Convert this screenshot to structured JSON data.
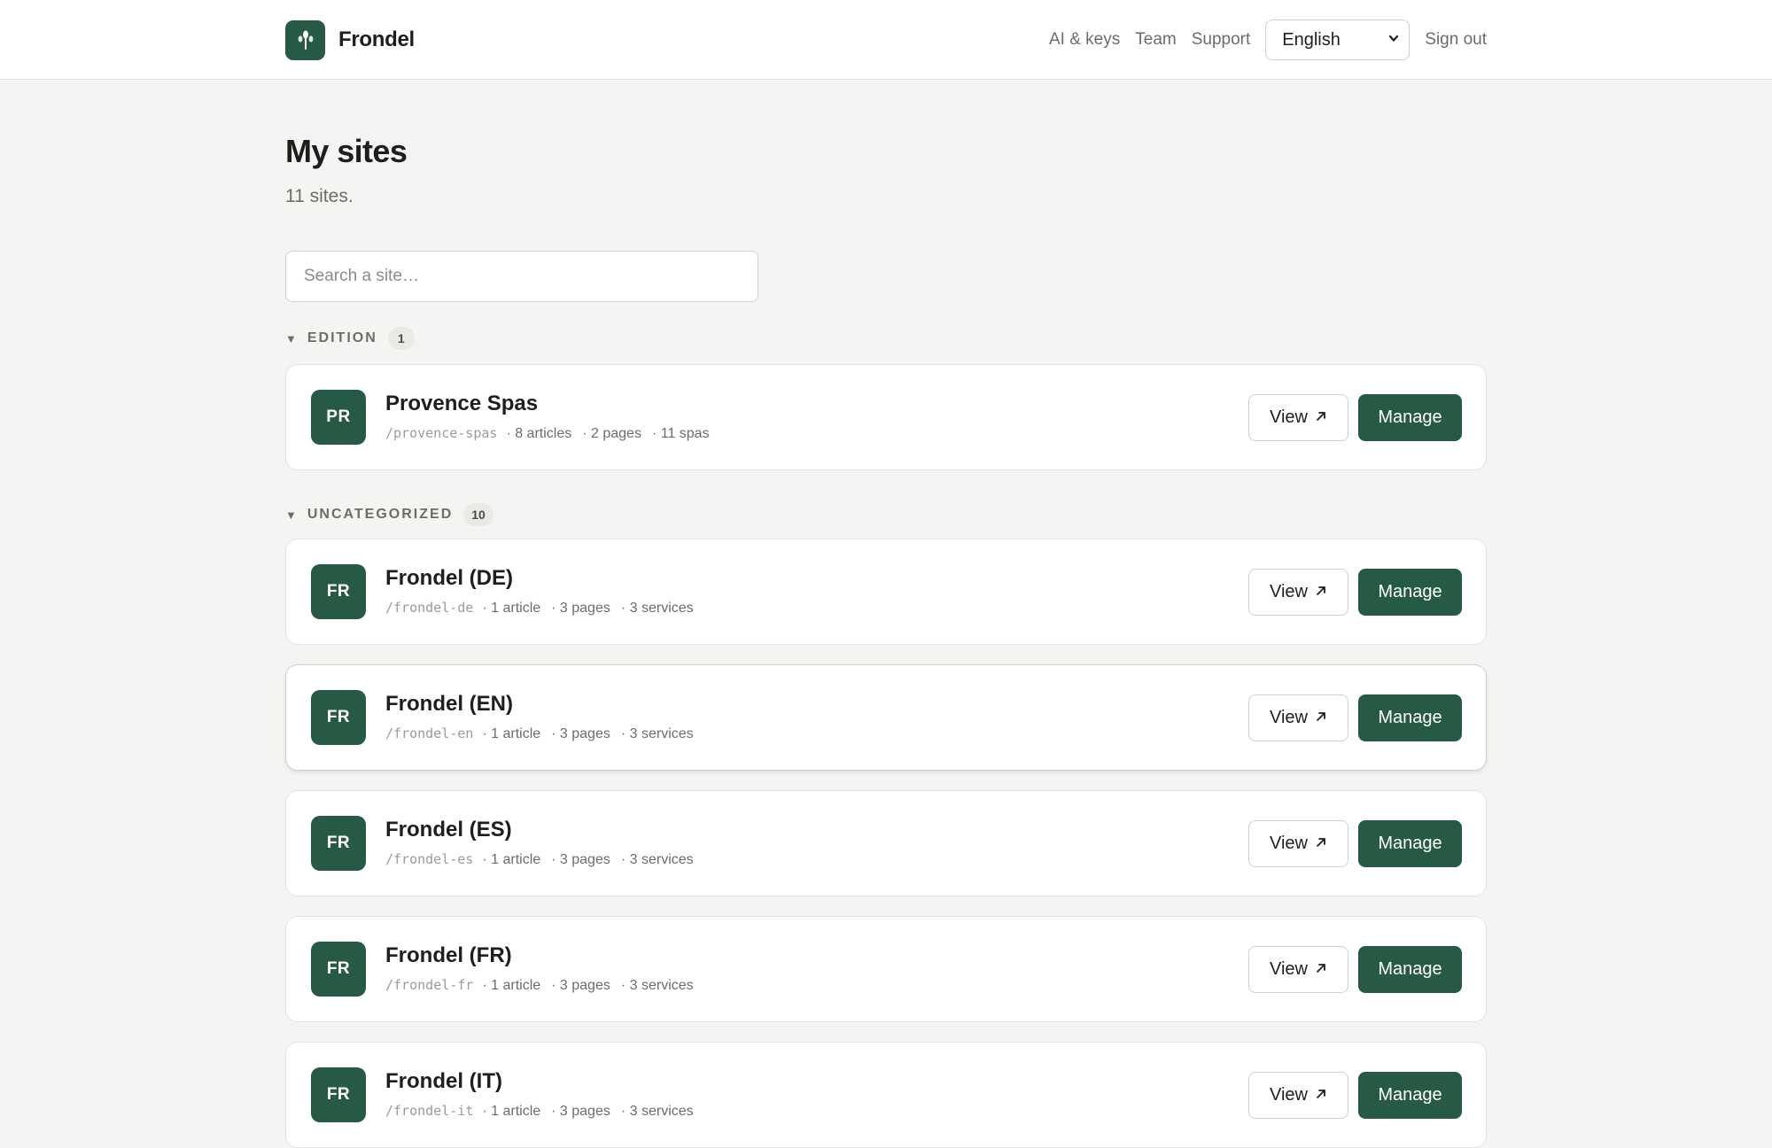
{
  "app": {
    "name": "Frondel"
  },
  "nav": {
    "ai_keys": "AI & keys",
    "team": "Team",
    "support": "Support",
    "language": "English",
    "sign_out": "Sign out"
  },
  "main": {
    "title": "My sites",
    "subtitle": "11 sites.",
    "search_placeholder": "Search a site…"
  },
  "groups": [
    {
      "label": "EDITION",
      "count": "1",
      "sites": [
        {
          "initials": "PR",
          "name": "Provence Spas",
          "slug": "/provence-spas",
          "meta": [
            "· 8 articles",
            "· 2 pages",
            "· 11 spas"
          ]
        }
      ]
    },
    {
      "label": "UNCATEGORIZED",
      "count": "10",
      "sites": [
        {
          "initials": "FR",
          "name": "Frondel (DE)",
          "slug": "/frondel-de",
          "meta": [
            "· 1 article",
            "· 3 pages",
            "· 3 services"
          ]
        },
        {
          "initials": "FR",
          "name": "Frondel (EN)",
          "slug": "/frondel-en",
          "meta": [
            "· 1 article",
            "· 3 pages",
            "· 3 services"
          ]
        },
        {
          "initials": "FR",
          "name": "Frondel (ES)",
          "slug": "/frondel-es",
          "meta": [
            "· 1 article",
            "· 3 pages",
            "· 3 services"
          ]
        },
        {
          "initials": "FR",
          "name": "Frondel (FR)",
          "slug": "/frondel-fr",
          "meta": [
            "· 1 article",
            "· 3 pages",
            "· 3 services"
          ]
        },
        {
          "initials": "FR",
          "name": "Frondel (IT)",
          "slug": "/frondel-it",
          "meta": [
            "· 1 article",
            "· 3 pages",
            "· 3 services"
          ]
        }
      ]
    }
  ],
  "actions": {
    "view": "View",
    "manage": "Manage"
  },
  "icons": {
    "logo": "sprout-icon",
    "caret": "caret-down-icon",
    "external": "arrow-up-right-icon",
    "select": "chevron-down-icon"
  },
  "colors": {
    "brand": "#275a44",
    "background": "#f4f5f2"
  }
}
